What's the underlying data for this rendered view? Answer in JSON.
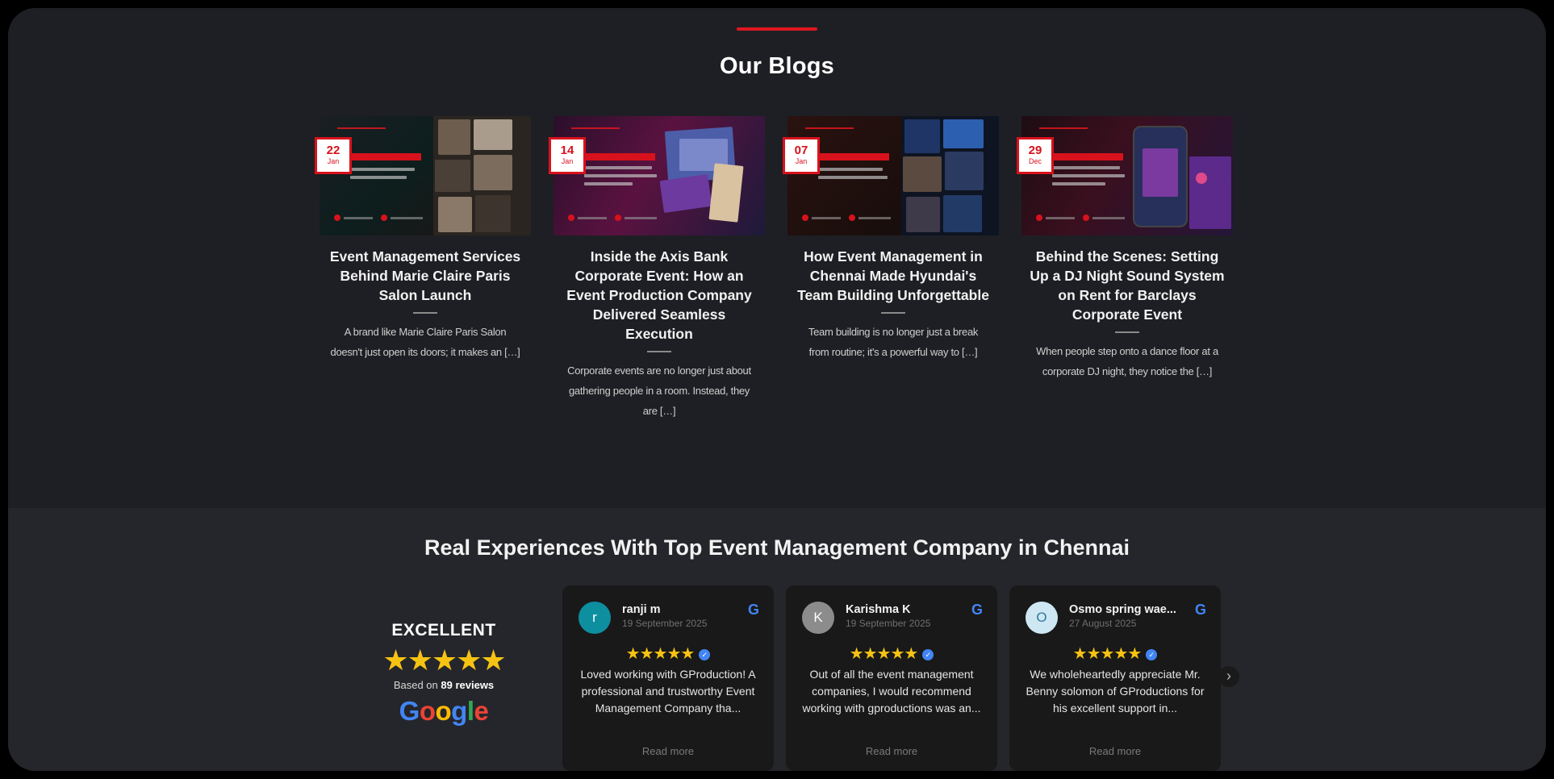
{
  "blogs": {
    "title": "Our Blogs",
    "items": [
      {
        "day": "22",
        "month": "Jan",
        "title": "Event Management Services Behind Marie Claire Paris Salon Launch",
        "excerpt": "A brand like Marie Claire Paris Salon doesn't just open its doors; it makes an […]"
      },
      {
        "day": "14",
        "month": "Jan",
        "title": "Inside the Axis Bank Corporate Event: How an Event Production Company Delivered Seamless Execution",
        "excerpt": "Corporate events are no longer just about gathering people in a room. Instead, they are […]"
      },
      {
        "day": "07",
        "month": "Jan",
        "title": "How Event Management in Chennai Made Hyundai's Team Building Unforgettable",
        "excerpt": "Team building is no longer just a break from routine; it's a powerful way to […]"
      },
      {
        "day": "29",
        "month": "Dec",
        "title": "Behind the Scenes: Setting Up a DJ Night Sound System on Rent for Barclays Corporate Event",
        "excerpt": "When people step onto a dance floor at a corporate DJ night, they notice the […]"
      }
    ]
  },
  "reviews": {
    "title": "Real Experiences With Top Event Management Company in Chennai",
    "summary": {
      "label": "EXCELLENT",
      "stars": "★★★★★",
      "based_prefix": "Based on",
      "count": "89 reviews",
      "google": [
        "G",
        "o",
        "o",
        "g",
        "l",
        "e"
      ]
    },
    "items": [
      {
        "initial": "r",
        "avatar_color": "#0e8fa0",
        "name": "ranji m",
        "date": "19 September 2025",
        "stars": "★★★★★",
        "text": "Loved working with GProduction! A professional and trustworthy Event Management Company tha...",
        "more": "Read more"
      },
      {
        "initial": "K",
        "avatar_color": "#8c8c8c",
        "name": "Karishma K",
        "date": "19 September 2025",
        "stars": "★★★★★",
        "text": "Out of all the event management companies, I would recommend working with gproductions was an...",
        "more": "Read more"
      },
      {
        "initial": "O",
        "avatar_color": "#cfe7f2",
        "name": "Osmo spring wae...",
        "date": "27 August 2025",
        "stars": "★★★★★",
        "text": "We wholeheartedly appreciate Mr. Benny solomon of GProductions for his excellent support in...",
        "more": "Read more"
      }
    ],
    "next_icon": "chevron-right-icon"
  }
}
